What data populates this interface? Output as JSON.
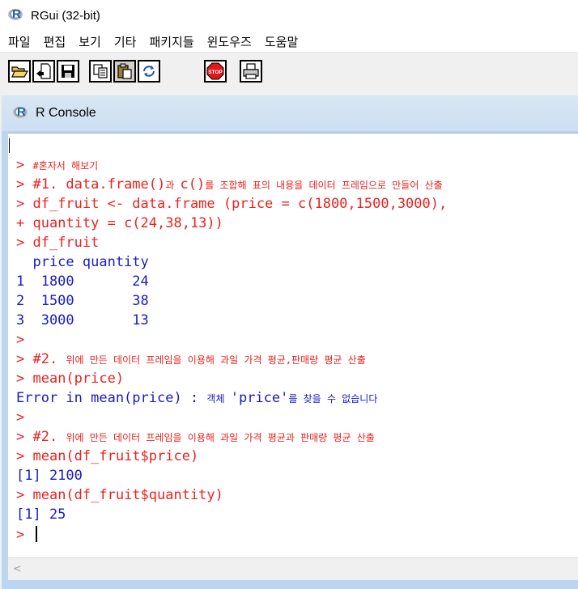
{
  "window": {
    "title": "RGui (32-bit)",
    "logo_letter": "R"
  },
  "menu": [
    "파일",
    "편집",
    "보기",
    "기타",
    "패키지들",
    "윈도우즈",
    "도움말"
  ],
  "toolbar": [
    {
      "name": "open-script-button",
      "icon": "open-folder-icon"
    },
    {
      "name": "load-workspace-button",
      "icon": "load-workspace-icon"
    },
    {
      "name": "save-workspace-button",
      "icon": "floppy-disk-icon"
    },
    {
      "name": "copy-button",
      "icon": "copy-icon"
    },
    {
      "name": "paste-button",
      "icon": "paste-icon"
    },
    {
      "name": "copy-paste-button",
      "icon": "refresh-icon"
    },
    {
      "name": "stop-button",
      "icon": "stop-sign-icon",
      "label": "STOP"
    },
    {
      "name": "print-button",
      "icon": "printer-icon"
    }
  ],
  "console": {
    "title": "R Console",
    "lines": [
      {
        "p": "> ",
        "code": "",
        "kr": "#혼자서 해보기",
        "tail": ""
      },
      {
        "p": "> ",
        "code": "#1. data.frame()",
        "kr": "과 ",
        "tail": "c()"
      },
      {
        "p": "> ",
        "code": "df_fruit <- data.frame (price = c(1800,1500,3000),",
        "kr": "",
        "tail": ""
      },
      {
        "p": "+ ",
        "code": "quantity = c(24,38,13))",
        "kr": "",
        "tail": ""
      },
      {
        "p": "> ",
        "code": "df_fruit",
        "kr": "",
        "tail": ""
      },
      {
        "p": "",
        "code": "  price quantity",
        "kr": "",
        "tail": "",
        "out": true
      },
      {
        "p": "",
        "code": "1  1800       24",
        "kr": "",
        "tail": "",
        "out": true
      },
      {
        "p": "",
        "code": "2  1500       38",
        "kr": "",
        "tail": "",
        "out": true
      },
      {
        "p": "",
        "code": "3  3000       13",
        "kr": "",
        "tail": "",
        "out": true
      },
      {
        "p": ">",
        "code": "",
        "kr": "",
        "tail": ""
      },
      {
        "p": "> ",
        "code": "#2. ",
        "kr": "위에 만든 데이터 프레임을 이용해 과일 가격 평균,판매량 평균 산출",
        "tail": ""
      },
      {
        "p": "> ",
        "code": "mean(price)",
        "kr": "",
        "tail": ""
      },
      {
        "p": "",
        "code": "Error in mean(price) : ",
        "kr": "객체 ",
        "tail": "'price'",
        "kr2": "를 찾을 수 없습니다",
        "out": true
      },
      {
        "p": ">",
        "code": "",
        "kr": "",
        "tail": ""
      },
      {
        "p": "> ",
        "code": "#2. ",
        "kr": "위에 만든 데이터 프레임을 이용해 과일 가격 평균과 판매량 평균 산출",
        "tail": ""
      },
      {
        "p": "> ",
        "code": "mean(df_fruit$price)",
        "kr": "",
        "tail": ""
      },
      {
        "p": "",
        "code": "[1] 2100",
        "kr": "",
        "tail": "",
        "out": true
      },
      {
        "p": "> ",
        "code": "mean(df_fruit$quantity)",
        "kr": "",
        "tail": ""
      },
      {
        "p": "",
        "code": "[1] 25",
        "kr": "",
        "tail": "",
        "out": true
      },
      {
        "p": "> ",
        "code": "",
        "kr": "",
        "tail": "",
        "cursor": true
      }
    ],
    "line2_kr_tail": "를 조합해 표의 내용을 데이터 프레임으로 만들어 산출"
  },
  "scrollbar": {
    "left_arrow": "<"
  },
  "colors": {
    "input": "#e8231f",
    "output": "#1a1ac4",
    "mdi_background": "#bcd6ef"
  }
}
